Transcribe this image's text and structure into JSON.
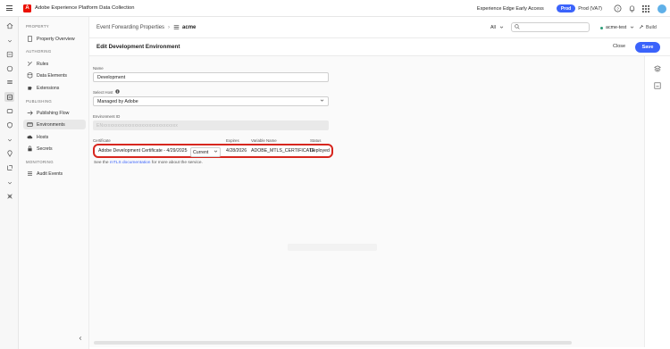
{
  "app": {
    "title": "Adobe Experience Platform Data Collection",
    "logo_letter": "A",
    "sandbox": "Experience Edge Early Access",
    "prod_badge": "Prod",
    "prod_name": "Prod (VA7)"
  },
  "sidenav": {
    "sections": {
      "property": "PROPERTY",
      "authoring": "AUTHORING",
      "publishing": "PUBLISHING",
      "monitoring": "MONITORING"
    },
    "items": [
      {
        "label": "Property Overview",
        "icon": "document-icon"
      },
      {
        "label": "Rules",
        "icon": "rules-icon"
      },
      {
        "label": "Data Elements",
        "icon": "data-elements-icon"
      },
      {
        "label": "Extensions",
        "icon": "extensions-icon"
      },
      {
        "label": "Publishing Flow",
        "icon": "publishing-flow-icon"
      },
      {
        "label": "Environments",
        "icon": "environments-icon",
        "active": true
      },
      {
        "label": "Hosts",
        "icon": "cloud-icon"
      },
      {
        "label": "Secrets",
        "icon": "lock-icon"
      },
      {
        "label": "Audit Events",
        "icon": "list-icon"
      }
    ]
  },
  "breadcrumb": {
    "parent": "Event Forwarding Properties",
    "separator": "›",
    "current": "acme"
  },
  "toolbar": {
    "filter_value": "All",
    "search_placeholder": "",
    "environment": "acme-test",
    "build_label": "Build"
  },
  "page": {
    "title": "Edit Development Environment",
    "close_label": "Close",
    "save_label": "Save"
  },
  "form": {
    "name_label": "Name",
    "name_value": "Development",
    "host_label": "Select Host",
    "host_value": "Managed by Adobe",
    "env_id_label": "Environment ID",
    "env_id_value": "ENxxxxxxxxxxxxxxxxxxxxxxxxxxxxxxx"
  },
  "certificate": {
    "headers": {
      "certificate": "Certificate",
      "expires": "Expires",
      "variable_name": "Variable Name",
      "status": "Status"
    },
    "row": {
      "name": "Adobe Development Certificate - 4/29/2025",
      "version": "Current",
      "expires": "4/28/2026",
      "variable_name": "ADOBE_MTLS_CERTIFICATE",
      "status": "Deployed"
    },
    "help_prefix": "See the ",
    "help_link": "mTLS documentation",
    "help_suffix": " for more about the service."
  },
  "colors": {
    "accent": "#3b63fb",
    "brand": "#eb1000",
    "highlight": "#d7261e"
  }
}
